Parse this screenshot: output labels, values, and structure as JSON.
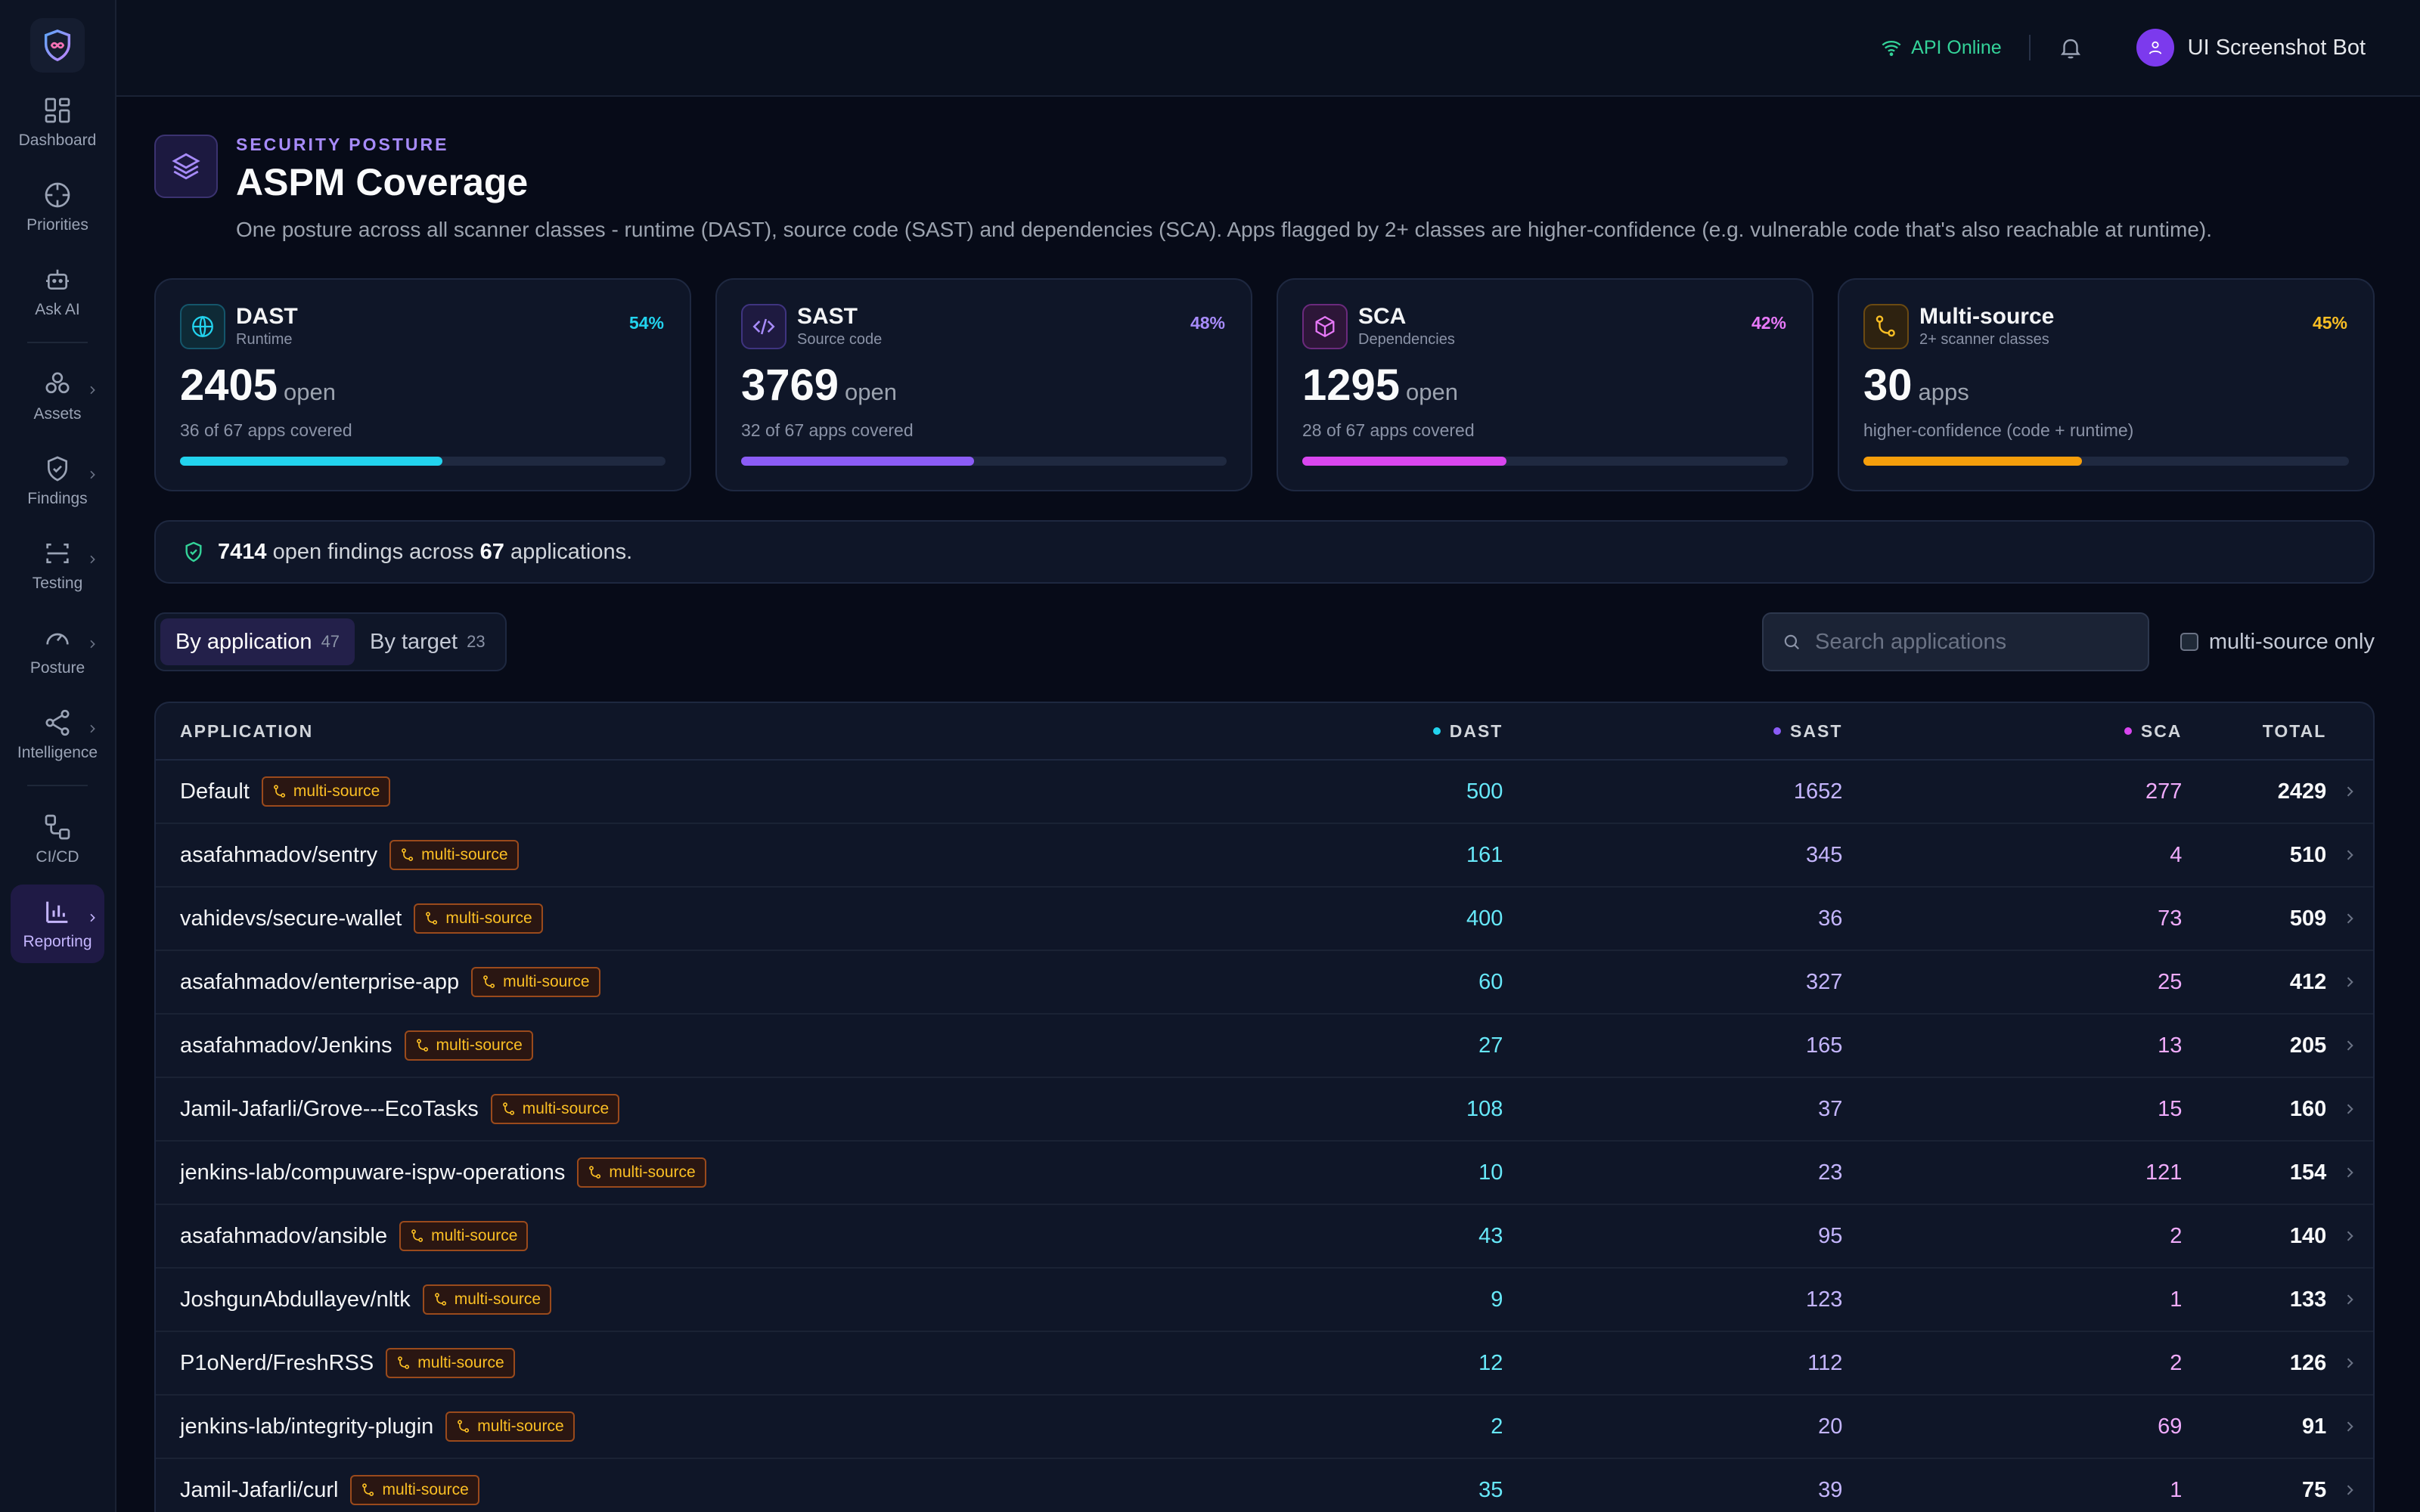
{
  "sidebar": {
    "items": [
      {
        "label": "Dashboard",
        "icon": "dashboard-icon"
      },
      {
        "label": "Priorities",
        "icon": "crosshair-icon"
      },
      {
        "label": "Ask AI",
        "icon": "bot-icon"
      },
      {
        "label": "Assets",
        "icon": "boxes-icon"
      },
      {
        "label": "Findings",
        "icon": "shield-check-icon"
      },
      {
        "label": "Testing",
        "icon": "scan-icon"
      },
      {
        "label": "Posture",
        "icon": "gauge-icon"
      },
      {
        "label": "Intelligence",
        "icon": "share-icon"
      },
      {
        "label": "CI/CD",
        "icon": "workflow-icon"
      },
      {
        "label": "Reporting",
        "icon": "bar-chart-icon"
      }
    ],
    "active": "Reporting"
  },
  "topbar": {
    "api_status": "API Online",
    "user_name": "UI Screenshot Bot"
  },
  "header": {
    "eyebrow": "SECURITY POSTURE",
    "title": "ASPM Coverage",
    "subtitle": "One posture across all scanner classes - runtime (DAST), source code (SAST) and dependencies (SCA). Apps flagged by 2+ classes are higher-confidence (e.g. vulnerable code that's also reachable at runtime)."
  },
  "cards": [
    {
      "name": "DAST",
      "sub": "Runtime",
      "pct": "54%",
      "fill": 0.54,
      "big": "2405",
      "unit": "open",
      "note": "36 of 67 apps covered",
      "color": "#22d3ee",
      "icon": "globe-icon"
    },
    {
      "name": "SAST",
      "sub": "Source code",
      "pct": "48%",
      "fill": 0.48,
      "big": "3769",
      "unit": "open",
      "note": "32 of 67 apps covered",
      "color": "#8b5cf6",
      "icon": "code-icon"
    },
    {
      "name": "SCA",
      "sub": "Dependencies",
      "pct": "42%",
      "fill": 0.42,
      "big": "1295",
      "unit": "open",
      "note": "28 of 67 apps covered",
      "color": "#d946ef",
      "icon": "package-icon"
    },
    {
      "name": "Multi-source",
      "sub": "2+ scanner classes",
      "pct": "45%",
      "fill": 0.45,
      "big": "30",
      "unit": "apps",
      "note": "higher-confidence (code + runtime)",
      "color": "#f59e0b",
      "icon": "git-merge-icon"
    }
  ],
  "summary": {
    "findings": "7414",
    "text_mid": " open findings across ",
    "apps": "67",
    "text_end": " applications."
  },
  "tabs": [
    {
      "label": "By application",
      "count": "47"
    },
    {
      "label": "By target",
      "count": "23"
    }
  ],
  "search": {
    "placeholder": "Search applications",
    "value": ""
  },
  "multi_source_only": {
    "label": "multi-source only",
    "checked": false
  },
  "table": {
    "columns": {
      "app": "APPLICATION",
      "dast": "DAST",
      "sast": "SAST",
      "sca": "SCA",
      "total": "TOTAL"
    },
    "badge_label": "multi-source",
    "rows": [
      {
        "app": "Default",
        "dast": "500",
        "sast": "1652",
        "sca": "277",
        "total": "2429"
      },
      {
        "app": "asafahmadov/sentry",
        "dast": "161",
        "sast": "345",
        "sca": "4",
        "total": "510"
      },
      {
        "app": "vahidevs/secure-wallet",
        "dast": "400",
        "sast": "36",
        "sca": "73",
        "total": "509"
      },
      {
        "app": "asafahmadov/enterprise-app",
        "dast": "60",
        "sast": "327",
        "sca": "25",
        "total": "412"
      },
      {
        "app": "asafahmadov/Jenkins",
        "dast": "27",
        "sast": "165",
        "sca": "13",
        "total": "205"
      },
      {
        "app": "Jamil-Jafarli/Grove---EcoTasks",
        "dast": "108",
        "sast": "37",
        "sca": "15",
        "total": "160"
      },
      {
        "app": "jenkins-lab/compuware-ispw-operations",
        "dast": "10",
        "sast": "23",
        "sca": "121",
        "total": "154"
      },
      {
        "app": "asafahmadov/ansible",
        "dast": "43",
        "sast": "95",
        "sca": "2",
        "total": "140"
      },
      {
        "app": "JoshgunAbdullayev/nltk",
        "dast": "9",
        "sast": "123",
        "sca": "1",
        "total": "133"
      },
      {
        "app": "P1oNerd/FreshRSS",
        "dast": "12",
        "sast": "112",
        "sca": "2",
        "total": "126"
      },
      {
        "app": "jenkins-lab/integrity-plugin",
        "dast": "2",
        "sast": "20",
        "sca": "69",
        "total": "91"
      },
      {
        "app": "Jamil-Jafarli/curl",
        "dast": "35",
        "sast": "39",
        "sca": "1",
        "total": "75"
      }
    ]
  }
}
